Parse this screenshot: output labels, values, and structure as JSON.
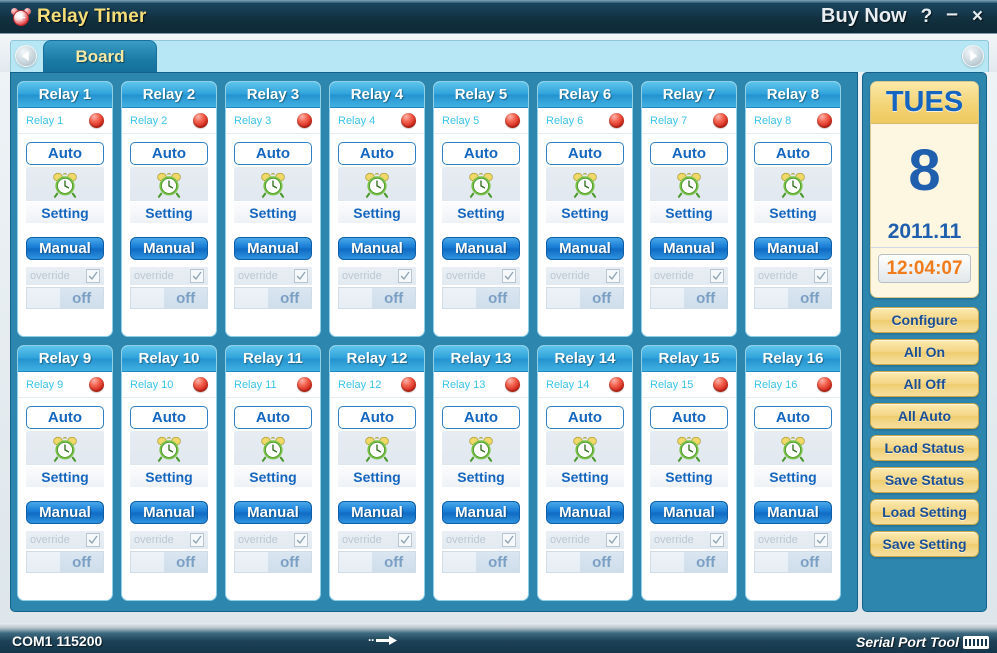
{
  "window": {
    "title": "Relay Timer",
    "icon": "alarm-clock-icon",
    "buy_now": "Buy Now",
    "help": "?",
    "minimize": "–",
    "close": "×"
  },
  "tabs": {
    "prev_arrow": "◀",
    "next_arrow": "▶",
    "items": [
      {
        "label": "Board",
        "active": true
      }
    ]
  },
  "relay_defaults": {
    "auto_label": "Auto",
    "setting_label": "Setting",
    "manual_label": "Manual",
    "override_label": "override",
    "override_checked": true,
    "state_label": "off",
    "value": "",
    "led_color": "#cc2012",
    "alarm_icon": "alarm-clock-icon",
    "check_icon": "checkmark-icon"
  },
  "relays": [
    {
      "title": "Relay 1",
      "name": "Relay 1"
    },
    {
      "title": "Relay 2",
      "name": "Relay 2"
    },
    {
      "title": "Relay 3",
      "name": "Relay 3"
    },
    {
      "title": "Relay 4",
      "name": "Relay 4"
    },
    {
      "title": "Relay 5",
      "name": "Relay 5"
    },
    {
      "title": "Relay 6",
      "name": "Relay 6"
    },
    {
      "title": "Relay 7",
      "name": "Relay 7"
    },
    {
      "title": "Relay 8",
      "name": "Relay 8"
    },
    {
      "title": "Relay 9",
      "name": "Relay 9"
    },
    {
      "title": "Relay 10",
      "name": "Relay 10"
    },
    {
      "title": "Relay 11",
      "name": "Relay 11"
    },
    {
      "title": "Relay 12",
      "name": "Relay 12"
    },
    {
      "title": "Relay 13",
      "name": "Relay 13"
    },
    {
      "title": "Relay 14",
      "name": "Relay 14"
    },
    {
      "title": "Relay 15",
      "name": "Relay 15"
    },
    {
      "title": "Relay 16",
      "name": "Relay 16"
    }
  ],
  "sidebar": {
    "date": {
      "weekday": "TUES",
      "day": "8",
      "year_month": "2011.11",
      "time": "12:04:07"
    },
    "buttons": [
      {
        "label": "Configure"
      },
      {
        "label": "All On"
      },
      {
        "label": "All Off"
      },
      {
        "label": "All Auto"
      },
      {
        "label": "Load Status"
      },
      {
        "label": "Save Status"
      },
      {
        "label": "Load Setting"
      },
      {
        "label": "Save Setting"
      }
    ]
  },
  "statusbar": {
    "port": "COM1 115200",
    "transfer_icon": "arrow-right-icon",
    "brand": "Serial Port Tool"
  },
  "colors": {
    "title_text": "#f5dd79",
    "accent_blue": "#2d86ad",
    "relay_header": "#2fa3dc",
    "button_gold": "#f4d686",
    "time_orange": "#f07c1b",
    "led_red": "#cc2012",
    "date_blue": "#1f5fad"
  }
}
